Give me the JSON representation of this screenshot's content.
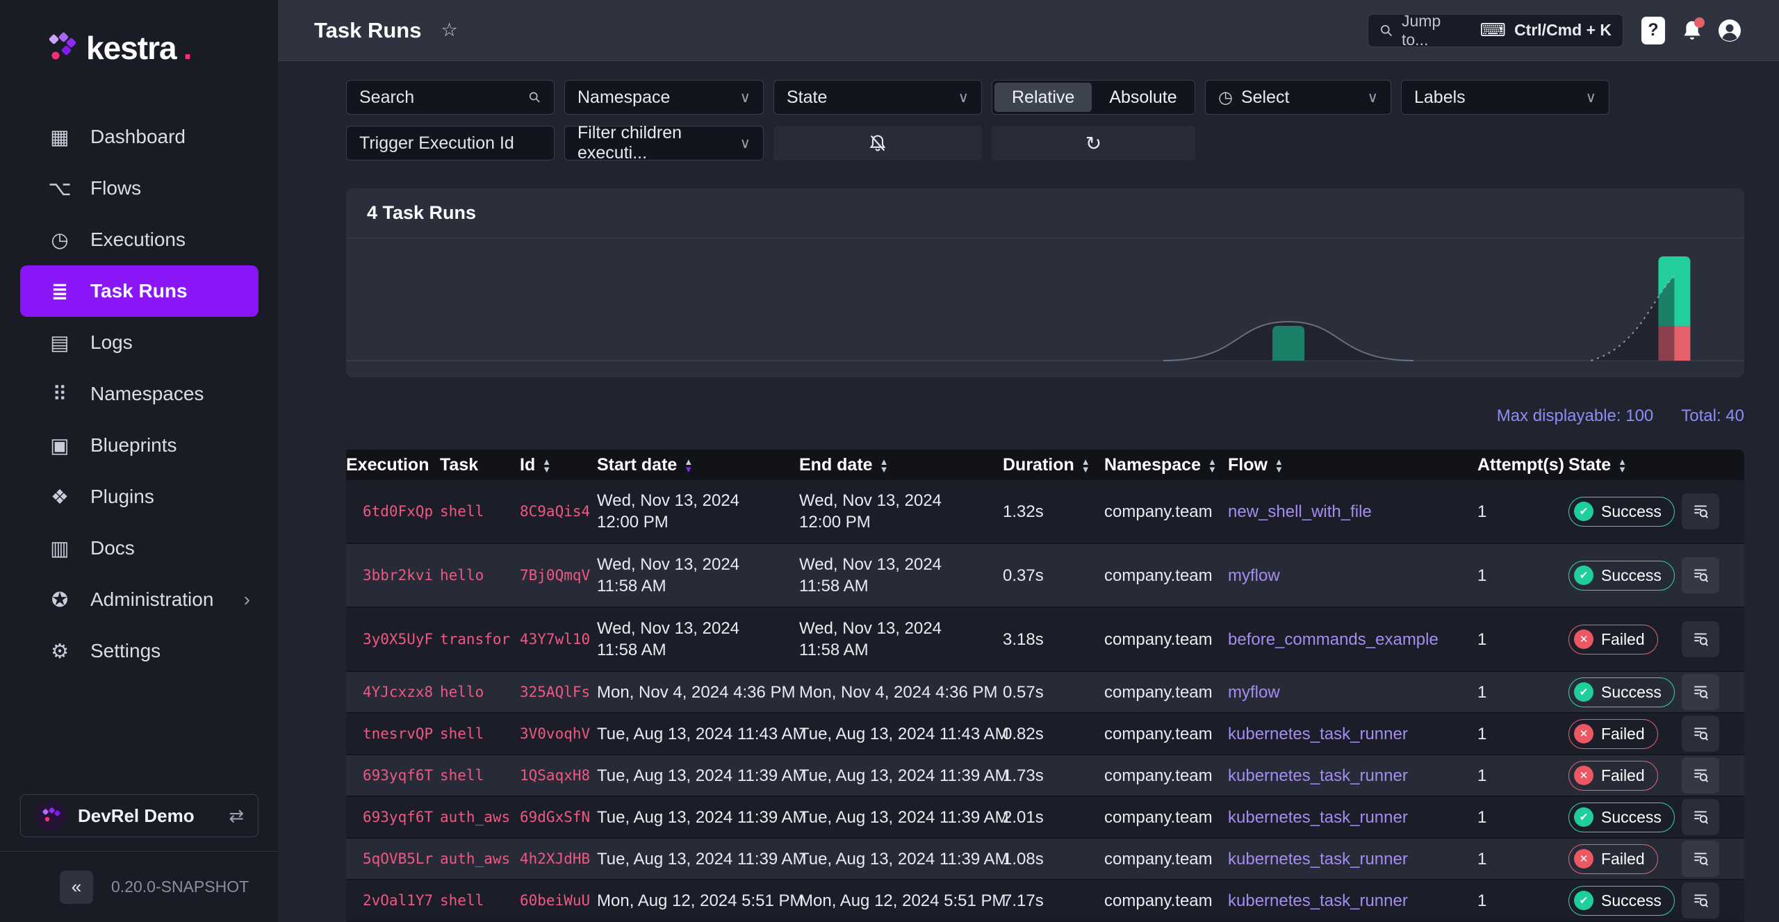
{
  "brand": {
    "logo": "kestra",
    "logo_dot": ".",
    "tenant": "DevRel Demo",
    "switch_glyph": "⇄",
    "collapse_glyph": "«",
    "version": "0.20.0-SNAPSHOT"
  },
  "sidebar": {
    "items": [
      {
        "name": "sidebar-item-dashboard",
        "icon": "dashboard-icon",
        "glyph": "▦",
        "label": "Dashboard"
      },
      {
        "name": "sidebar-item-flows",
        "icon": "flows-icon",
        "glyph": "⌥",
        "label": "Flows"
      },
      {
        "name": "sidebar-item-executions",
        "icon": "executions-icon",
        "glyph": "◷",
        "label": "Executions"
      },
      {
        "name": "sidebar-item-task-runs",
        "icon": "task-runs-icon",
        "glyph": "≣",
        "label": "Task Runs",
        "state": "active"
      },
      {
        "name": "sidebar-item-logs",
        "icon": "logs-icon",
        "glyph": "▤",
        "label": "Logs"
      },
      {
        "name": "sidebar-item-namespaces",
        "icon": "namespaces-icon",
        "glyph": "⠿",
        "label": "Namespaces"
      },
      {
        "name": "sidebar-item-blueprints",
        "icon": "blueprints-icon",
        "glyph": "▣",
        "label": "Blueprints"
      },
      {
        "name": "sidebar-item-plugins",
        "icon": "plugins-icon",
        "glyph": "❖",
        "label": "Plugins"
      },
      {
        "name": "sidebar-item-docs",
        "icon": "docs-icon",
        "glyph": "▥",
        "label": "Docs"
      },
      {
        "name": "sidebar-item-administration",
        "icon": "administration-icon",
        "glyph": "✪",
        "label": "Administration",
        "trailing": "›"
      },
      {
        "name": "sidebar-item-settings",
        "icon": "settings-icon",
        "glyph": "⚙",
        "label": "Settings"
      }
    ]
  },
  "topbar": {
    "title": "Task Runs",
    "star_glyph": "☆",
    "jump_placeholder": "Jump to...",
    "kbd_glyph": "⌨",
    "shortcut": "Ctrl/Cmd + K",
    "help_glyph": "?"
  },
  "filters": {
    "search_placeholder": "Search",
    "namespace": "Namespace",
    "state": "State",
    "relative": "Relative",
    "absolute": "Absolute",
    "select_clock_glyph": "◷",
    "select": "Select",
    "labels": "Labels",
    "trigger_execution_id_placeholder": "Trigger Execution Id",
    "filter_children": "Filter children executi...",
    "refresh_glyph": "↻"
  },
  "summary": {
    "title": "4 Task Runs",
    "max_displayable": "Max displayable: 100",
    "total": "Total: 40"
  },
  "chart_data": {
    "type": "bar",
    "stacked": true,
    "title": "4 Task Runs",
    "x_axis": "execution date",
    "legend_position": "none",
    "grid": false,
    "series": [
      {
        "name": "Success",
        "color": "#21CE9C"
      },
      {
        "name": "Failed",
        "color": "#E4606B"
      }
    ],
    "buckets": [
      {
        "x_frac": 0.674,
        "success": 1,
        "failed": 0,
        "overlay": "bell"
      },
      {
        "x_frac": 0.95,
        "success": 2,
        "failed": 1,
        "overlay": "rise",
        "shade": true
      }
    ],
    "overlay_line": "duration curve",
    "baseline": true
  },
  "table": {
    "columns": [
      {
        "label": "Execution",
        "sort": "none"
      },
      {
        "label": "Task",
        "sort": "none"
      },
      {
        "label": "Id",
        "sort": "both"
      },
      {
        "label": "Start date",
        "sort": "desc"
      },
      {
        "label": "End date",
        "sort": "both"
      },
      {
        "label": "Duration",
        "sort": "both"
      },
      {
        "label": "Namespace",
        "sort": "both"
      },
      {
        "label": "Flow",
        "sort": "both"
      },
      {
        "label": "Attempt(s)",
        "sort": "none"
      },
      {
        "label": "State",
        "sort": "both"
      },
      {
        "label": "",
        "sort": "none"
      }
    ],
    "rows": [
      {
        "execution": "6td0FxQp",
        "task": "shell",
        "id": "8C9aQis4",
        "start_date": "Wed, Nov 13, 2024 12:00 PM",
        "end_date": "Wed, Nov 13, 2024 12:00 PM",
        "duration": "1.32s",
        "namespace": "company.team",
        "flow": "new_shell_with_file",
        "attempts": "1",
        "state": "Success",
        "state_class": "success",
        "state_glyph": "✔",
        "row_class": "two-line"
      },
      {
        "execution": "3bbr2kvi",
        "task": "hello",
        "id": "7Bj0QmqV",
        "start_date": "Wed, Nov 13, 2024 11:58 AM",
        "end_date": "Wed, Nov 13, 2024 11:58 AM",
        "duration": "0.37s",
        "namespace": "company.team",
        "flow": "myflow",
        "attempts": "1",
        "state": "Success",
        "state_class": "success",
        "state_glyph": "✔",
        "row_class": "two-line"
      },
      {
        "execution": "3y0X5UyF",
        "task": "transfor",
        "id": "43Y7wl10",
        "start_date": "Wed, Nov 13, 2024 11:58 AM",
        "end_date": "Wed, Nov 13, 2024 11:58 AM",
        "duration": "3.18s",
        "namespace": "company.team",
        "flow": "before_commands_example",
        "attempts": "1",
        "state": "Failed",
        "state_class": "failed",
        "state_glyph": "✕",
        "row_class": "two-line"
      },
      {
        "execution": "4YJcxzx8",
        "task": "hello",
        "id": "325AQlFs",
        "start_date": "Mon, Nov 4, 2024 4:36 PM",
        "end_date": "Mon, Nov 4, 2024 4:36 PM",
        "duration": "0.57s",
        "namespace": "company.team",
        "flow": "myflow",
        "attempts": "1",
        "state": "Success",
        "state_class": "success",
        "state_glyph": "✔",
        "row_class": "one-line"
      },
      {
        "execution": "tnesrvQP",
        "task": "shell",
        "id": "3V0voqhV",
        "start_date": "Tue, Aug 13, 2024 11:43 AM",
        "end_date": "Tue, Aug 13, 2024 11:43 AM",
        "duration": "0.82s",
        "namespace": "company.team",
        "flow": "kubernetes_task_runner",
        "attempts": "1",
        "state": "Failed",
        "state_class": "failed",
        "state_glyph": "✕",
        "row_class": "one-line"
      },
      {
        "execution": "693yqf6T",
        "task": "shell",
        "id": "1QSaqxH8",
        "start_date": "Tue, Aug 13, 2024 11:39 AM",
        "end_date": "Tue, Aug 13, 2024 11:39 AM",
        "duration": "1.73s",
        "namespace": "company.team",
        "flow": "kubernetes_task_runner",
        "attempts": "1",
        "state": "Failed",
        "state_class": "failed",
        "state_glyph": "✕",
        "row_class": "one-line"
      },
      {
        "execution": "693yqf6T",
        "task": "auth_aws",
        "id": "69dGxSfN",
        "start_date": "Tue, Aug 13, 2024 11:39 AM",
        "end_date": "Tue, Aug 13, 2024 11:39 AM",
        "duration": "2.01s",
        "namespace": "company.team",
        "flow": "kubernetes_task_runner",
        "attempts": "1",
        "state": "Success",
        "state_class": "success",
        "state_glyph": "✔",
        "row_class": "one-line"
      },
      {
        "execution": "5qOVB5Lr",
        "task": "auth_aws",
        "id": "4h2XJdHB",
        "start_date": "Tue, Aug 13, 2024 11:39 AM",
        "end_date": "Tue, Aug 13, 2024 11:39 AM",
        "duration": "1.08s",
        "namespace": "company.team",
        "flow": "kubernetes_task_runner",
        "attempts": "1",
        "state": "Failed",
        "state_class": "failed",
        "state_glyph": "✕",
        "row_class": "one-line"
      },
      {
        "execution": "2vOal1Y7",
        "task": "shell",
        "id": "60beiWuU",
        "start_date": "Mon, Aug 12, 2024 5:51 PM",
        "end_date": "Mon, Aug 12, 2024 5:51 PM",
        "duration": "7.17s",
        "namespace": "company.team",
        "flow": "kubernetes_task_runner",
        "attempts": "1",
        "state": "Success",
        "state_class": "success",
        "state_glyph": "✔",
        "row_class": "one-line"
      }
    ]
  }
}
